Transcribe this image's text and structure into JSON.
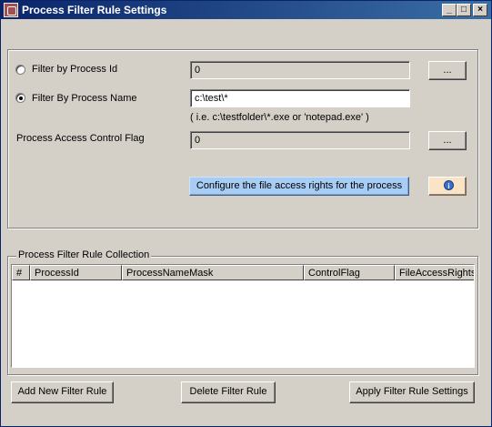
{
  "window": {
    "title": "Process Filter Rule Settings",
    "controls": {
      "minimize": "_",
      "maximize": "□",
      "close": "×"
    }
  },
  "filter": {
    "by_id_label": "Filter by Process Id",
    "by_id_value": "0",
    "by_id_browse": "...",
    "by_name_label": "Filter By Process Name",
    "by_name_value": "c:\\test\\*",
    "example_hint": "( i.e. c:\\testfolder\\*.exe  or  'notepad.exe' )",
    "access_flag_label": "Process Access Control Flag",
    "access_flag_value": "0",
    "access_flag_browse": "...",
    "configure_button": "Configure the file access rights for the process",
    "info_icon": "i",
    "selected_mode": "by_name"
  },
  "collection": {
    "title": "Process Filter Rule Collection",
    "columns": [
      "#",
      "ProcessId",
      "ProcessNameMask",
      "ControlFlag",
      "FileAccessRights"
    ],
    "rows": []
  },
  "buttons": {
    "add": "Add New Filter Rule",
    "delete": "Delete Filter Rule",
    "apply": "Apply Filter Rule Settings"
  },
  "colors": {
    "titlebar_start": "#0a246a",
    "titlebar_end": "#3a6ea5",
    "window_bg": "#d4d0c8",
    "configure_button_bg": "#a8cdf5",
    "info_button_bg": "#fbe3c6"
  }
}
